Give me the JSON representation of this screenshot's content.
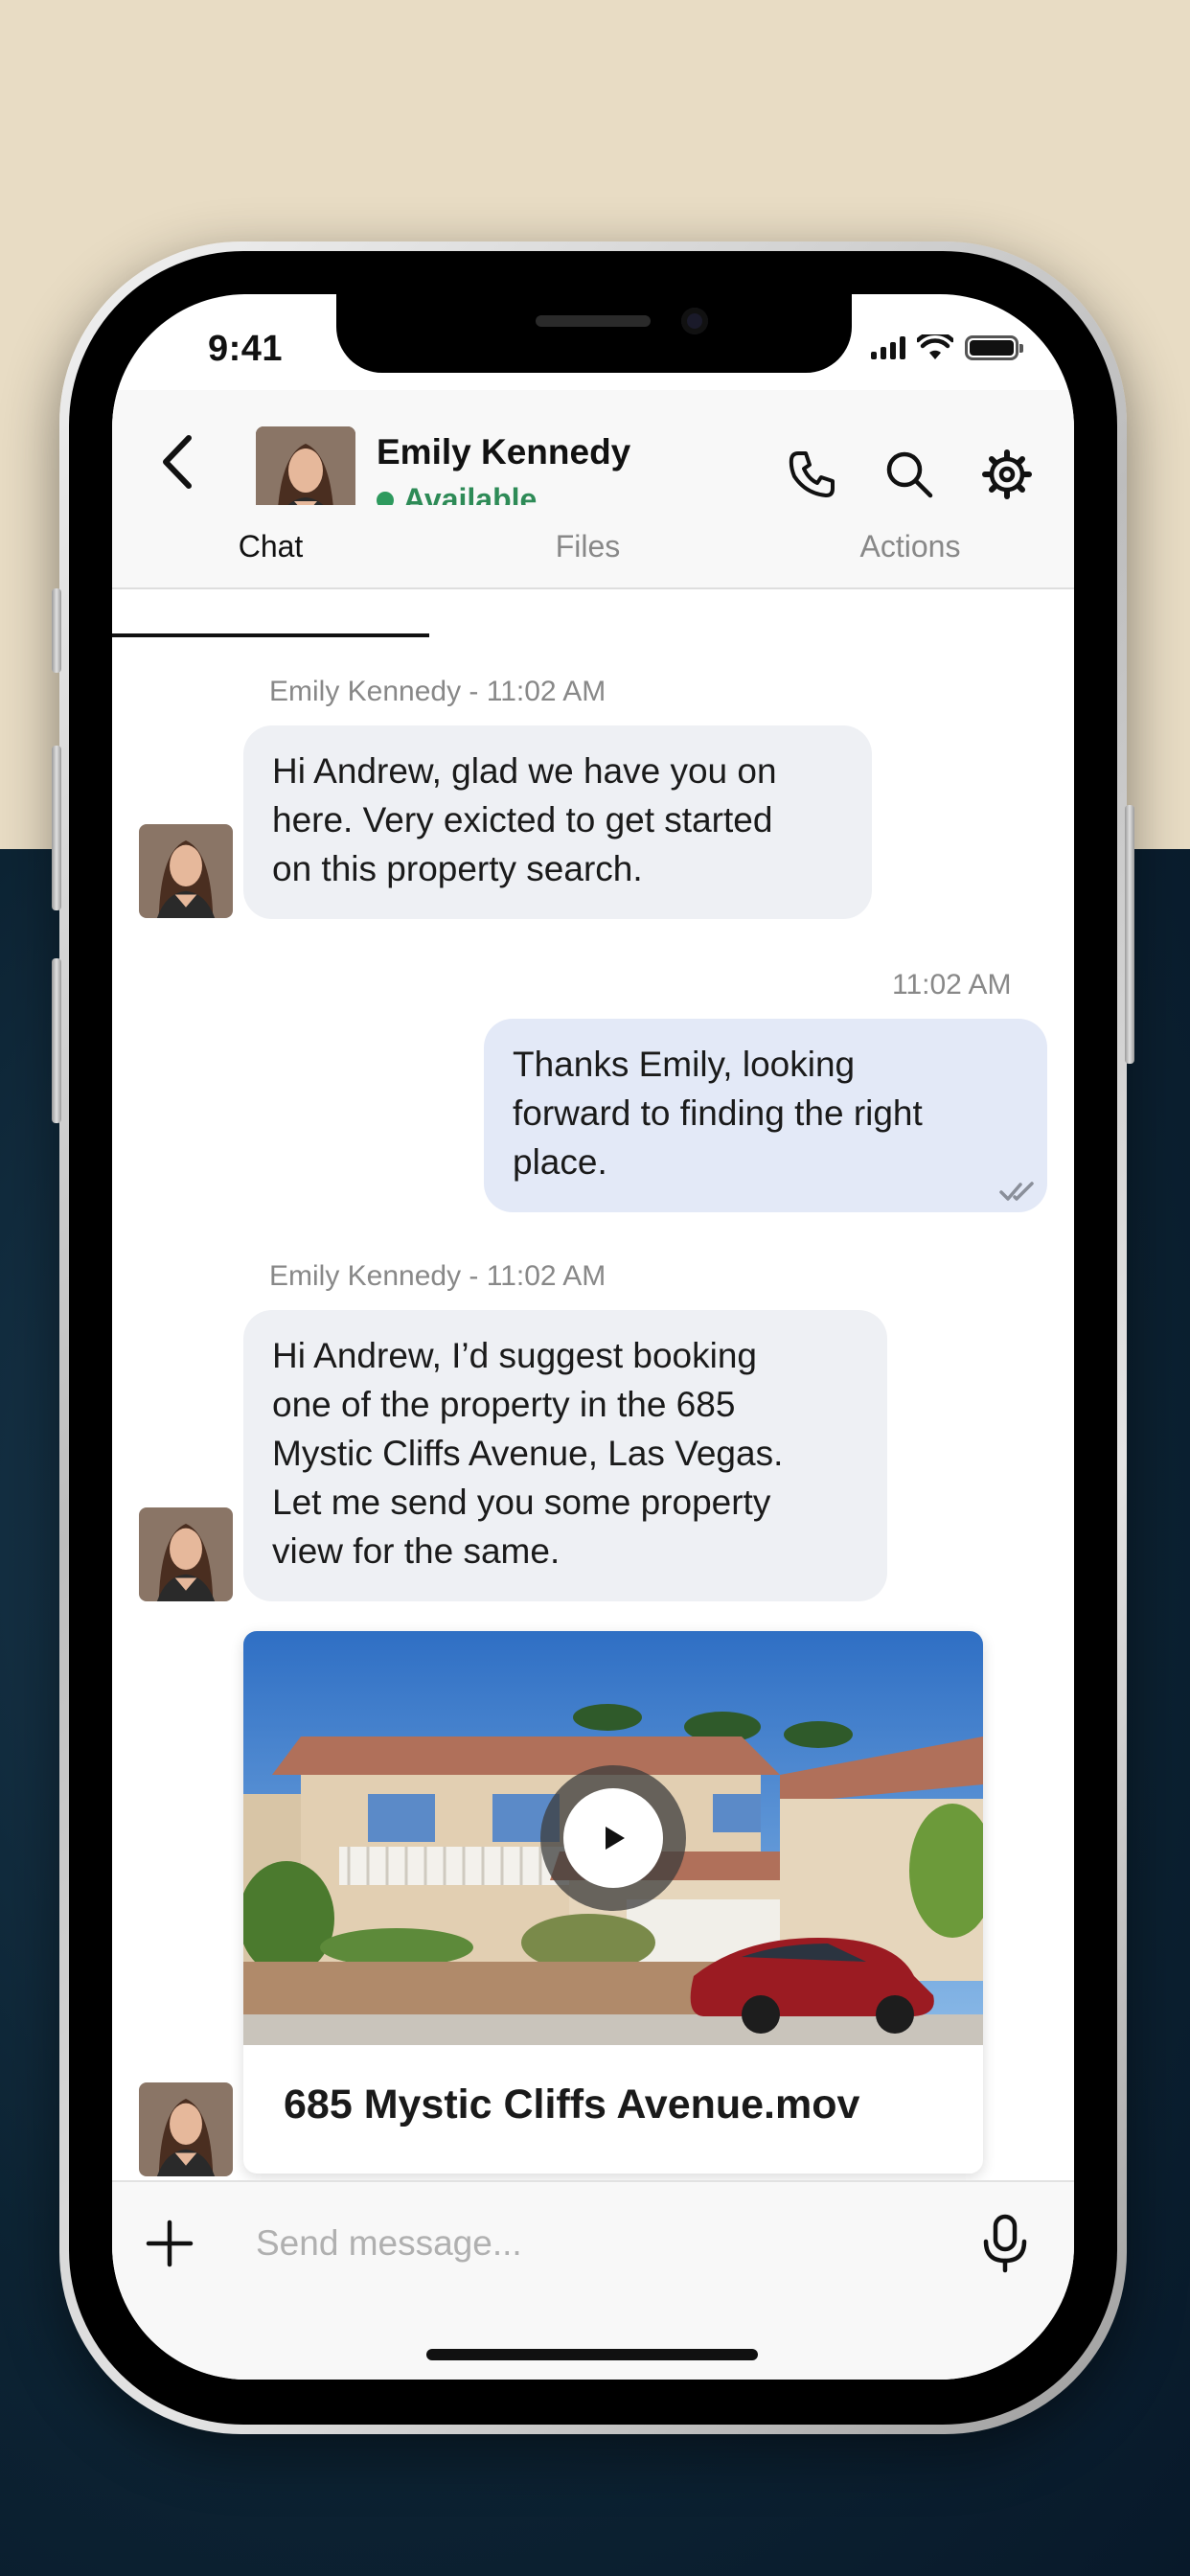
{
  "status_bar": {
    "time": "9:41"
  },
  "header": {
    "contact_name": "Emily Kennedy",
    "status": "Available",
    "status_color": "#2e9a5e",
    "icons": [
      "back-arrow-icon",
      "phone-icon",
      "search-icon",
      "gear-icon"
    ]
  },
  "tabs": [
    {
      "label": "Chat",
      "active": true
    },
    {
      "label": "Files",
      "active": false
    },
    {
      "label": "Actions",
      "active": false
    }
  ],
  "messages": [
    {
      "direction": "incoming",
      "meta": "Emily Kennedy - 11:02 AM",
      "lines": [
        "Hi Andrew, glad we have you on",
        "here. Very exicted to get started",
        "on this property search."
      ]
    },
    {
      "direction": "outgoing",
      "meta": "11:02 AM",
      "lines": [
        "Thanks Emily, looking",
        "forward to finding the right",
        "place."
      ],
      "read_icon": "double-check-icon"
    },
    {
      "direction": "incoming",
      "meta": "Emily Kennedy - 11:02 AM",
      "lines": [
        "Hi Andrew, I’d suggest booking",
        "one of the property in the 685",
        "Mystic Cliffs Avenue, Las Vegas.",
        "Let me send you some property",
        "view for the same."
      ]
    },
    {
      "direction": "incoming",
      "type": "media",
      "file_name": "685 Mystic Cliffs Avenue.mov",
      "icon": "play-icon"
    }
  ],
  "composer": {
    "placeholder": "Send message...",
    "value": ""
  },
  "colors": {
    "accent_out_bubble": "#e3e9f7",
    "in_bubble": "#eef0f4",
    "bg_top": "#e8dcc4",
    "bg_bottom": "#0f2a3c"
  }
}
